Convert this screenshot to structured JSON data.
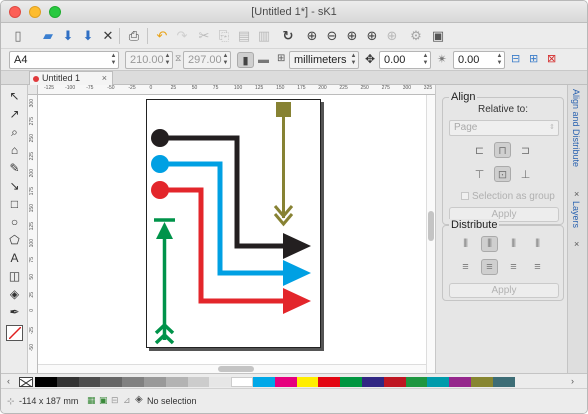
{
  "window": {
    "title": "[Untitled 1*] - sK1"
  },
  "toolbar": {
    "page_format": "A4",
    "width": "210.00",
    "height": "297.00",
    "units": "millimeters",
    "position_value": "0.00",
    "rotation_value": "0.00"
  },
  "tabs": [
    {
      "label": "Untitled 1",
      "close": "×"
    }
  ],
  "rulers": {
    "h_ticks": [
      "-125",
      "-100",
      "-75",
      "-50",
      "-25",
      "0",
      "25",
      "50",
      "75",
      "100",
      "125",
      "150",
      "175",
      "200",
      "225",
      "250",
      "275",
      "300",
      "325"
    ],
    "v_ticks": [
      "300",
      "275",
      "250",
      "225",
      "200",
      "175",
      "150",
      "125",
      "100",
      "75",
      "50",
      "25",
      "0",
      "-25",
      "-50"
    ]
  },
  "panel": {
    "align": {
      "title": "Align",
      "relative_to_label": "Relative to:",
      "relative_to_value": "Page",
      "checkbox_label": "Selection as group",
      "apply": "Apply"
    },
    "distribute": {
      "title": "Distribute",
      "apply": "Apply"
    }
  },
  "side_tabs": {
    "align_tab": "Align and Distribute",
    "close_x": "×",
    "layers_tab": "Layers",
    "close_x2": "×"
  },
  "status": {
    "coords": "-114 x 187 mm",
    "selection": "No selection"
  },
  "palette": {
    "colors": [
      "#000000",
      "#333333",
      "#4d4d4d",
      "#666666",
      "#808080",
      "#999999",
      "#b3b3b3",
      "#cccccc",
      "#e6e6e6",
      "#ffffff",
      "#00a8e8",
      "#e6007e",
      "#ffed00",
      "#e30613",
      "#009640",
      "#312783",
      "#be1622",
      "#1e9640",
      "#009bab",
      "#95278c",
      "#878631",
      "#3d6d76"
    ]
  },
  "drawing": {
    "colors": {
      "black": "#231f20",
      "cyan": "#00a0e3",
      "red": "#e3262b",
      "olive": "#878233",
      "green": "#00934a"
    }
  }
}
